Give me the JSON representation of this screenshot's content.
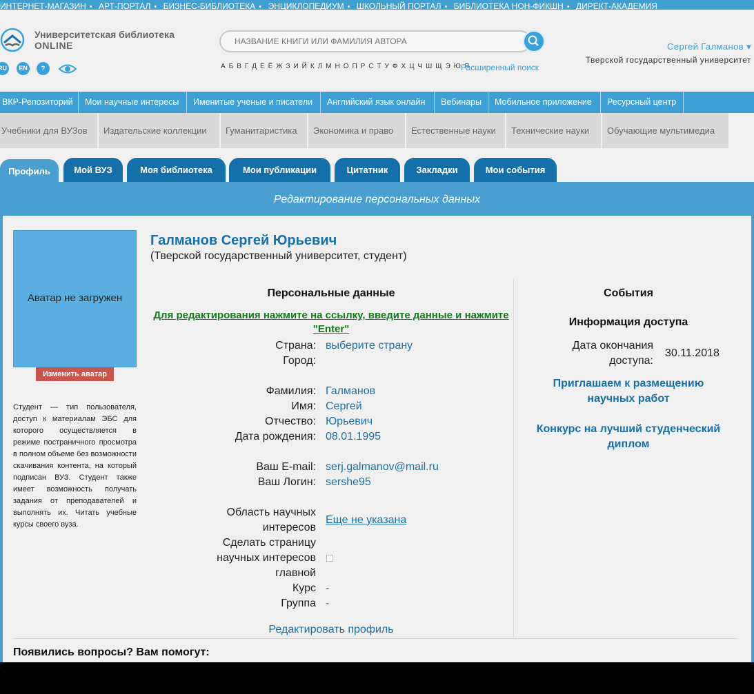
{
  "top_links": [
    "ИНТЕРНЕТ-МАГАЗИН",
    "АРТ-ПОРТАЛ",
    "БИЗНЕС-БИБЛИОТЕКА",
    "ЭНЦИКЛОПЕДИУМ",
    "ШКОЛЬНЫЙ ПОРТАЛ",
    "БИБЛИОТЕКА НОН-ФИКШН",
    "ДИРЕКТ-АКАДЕМИЯ"
  ],
  "logo": {
    "line1": "Университетская библиотека",
    "line2": "ONLINE"
  },
  "langs": [
    "RU",
    "EN",
    "?"
  ],
  "search": {
    "placeholder": "НАЗВАНИЕ КНИГИ ИЛИ ФАМИЛИЯ АВТОРА"
  },
  "alphabet": "А Б В Г Д Е Ё Ж З И Й К Л М Н О П Р С Т У Ф Х Ц Ч Ш Щ Э Ю Я",
  "advanced_search": "Расширенный поиск",
  "user": {
    "name": "Сергей Галманов ▾",
    "university": "Тверской государственный университет"
  },
  "nav1": [
    "ВКР-Репозиторий",
    "Мои научные интересы",
    "Именитые ученые и писатели",
    "Английский язык онлайн",
    "Вебинары",
    "Мобильное приложение",
    "Ресурсный центр"
  ],
  "nav2": [
    "Учебники для ВУЗов",
    "Издательские коллекции",
    "Гуманитаристика",
    "Экономика и право",
    "Естественные науки",
    "Технические науки",
    "Обучающие мультимедиа"
  ],
  "tabs": [
    "Профиль",
    "Мой ВУЗ",
    "Моя библиотека",
    "Мои публикации",
    "Цитатник",
    "Закладки",
    "Мои события"
  ],
  "banner": "Редактирование персональных данных",
  "avatar": {
    "placeholder": "Аватар не загружен",
    "change_button": "Изменить аватар"
  },
  "role_description": "Студент — тип пользователя, доступ к материалам ЭБС для которого осуществляется в режиме постраничного просмотра в полном объеме без возможности скачивания контента, на который подписан ВУЗ. Студент также имеет возможность получать задания от преподавателей и выполнять их. Читать учебные курсы своего вуза.",
  "profile": {
    "full_name": "Галманов Сергей Юрьевич",
    "subtitle": "(Тверской государственный университет, студент)"
  },
  "personal": {
    "title": "Персональные данные",
    "edit_hint": "Для редактирования нажмите на ссылку, введите данные и нажмите \"Enter\"",
    "country_label": "Страна:",
    "country_value": "выберите страну",
    "city_label": "Город:",
    "surname_label": "Фамилия:",
    "surname_value": "Галманов",
    "name_label": "Имя:",
    "name_value": "Сергей",
    "patronymic_label": "Отчество:",
    "patronymic_value": "Юрьевич",
    "birth_label": "Дата рождения:",
    "birth_value": "08.01.1995",
    "email_label": "Ваш E-mail:",
    "email_value": "serj.galmanov@mail.ru",
    "login_label": "Ваш Логин:",
    "login_value": "sershe95",
    "interests_label_1": "Область научных",
    "interests_label_2": "интересов",
    "interests_value": "Еще не указана",
    "main_page_label_1": "Сделать страницу",
    "main_page_label_2": "научных интересов",
    "main_page_label_3": "главной",
    "course_label": "Курс",
    "course_value": "-",
    "group_label": "Группа",
    "group_value": "-",
    "edit_profile": "Редактировать профиль"
  },
  "events": {
    "title": "События",
    "access_title": "Информация доступа",
    "access_label_1": "Дата окончания",
    "access_label_2": "доступа:",
    "access_value": "30.11.2018",
    "link1_1": "Приглашаем к размещению",
    "link1_2": "научных работ",
    "link2_1": "Конкурс на лучший студенческий",
    "link2_2": "диплом"
  },
  "help": "Появились вопросы? Вам помогут:",
  "colors": {
    "accent": "#3d9fd3",
    "tab_dark": "#1570a9",
    "link": "#1970a8",
    "hint_green": "#157a1a",
    "avatar_btn": "#c9554f"
  }
}
